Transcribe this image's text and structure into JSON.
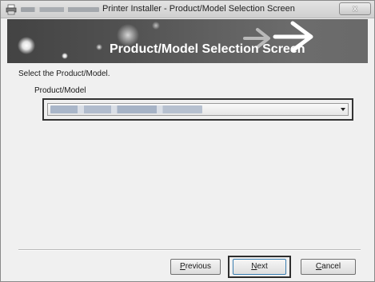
{
  "window": {
    "title": "Printer Installer - Product/Model Selection Screen",
    "close_label": "x",
    "title_icon": "printer-installer-icon"
  },
  "banner": {
    "heading": "Product/Model Selection Screen"
  },
  "content": {
    "instruction": "Select the Product/Model.",
    "field_label": "Product/Model"
  },
  "buttons": {
    "previous": {
      "accel": "P",
      "rest": "revious"
    },
    "next": {
      "accel": "N",
      "rest": "ext"
    },
    "cancel": {
      "accel": "C",
      "rest": "ancel"
    }
  },
  "icons": {
    "dropdown": "chevron-down-icon",
    "window_close": "close-icon"
  }
}
